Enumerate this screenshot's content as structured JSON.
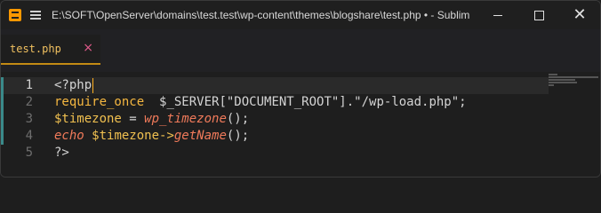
{
  "window": {
    "title": "E:\\SOFT\\OpenServer\\domains\\test.test\\wp-content\\themes\\blogshare\\test.php • - Sublim",
    "controls": {
      "minimize": "minimize",
      "maximize": "maximize",
      "close": "✕"
    }
  },
  "tabs": [
    {
      "label": "test.php",
      "close": "×",
      "active": true
    }
  ],
  "editor": {
    "lines": [
      {
        "number": "1",
        "tokens": [
          "<?php"
        ]
      },
      {
        "number": "2",
        "tokens": [
          "require_once",
          "  ",
          "$_SERVER[\"DOCUMENT_ROOT\"].\"/wp-load.php\";"
        ]
      },
      {
        "number": "3",
        "tokens": [
          "$timezone",
          " = ",
          "wp_timezone",
          "();"
        ]
      },
      {
        "number": "4",
        "tokens": [
          "echo",
          " ",
          "$timezone->",
          "getName",
          "();"
        ]
      },
      {
        "number": "5",
        "tokens": [
          "?>"
        ]
      }
    ]
  },
  "colors": {
    "accent": "#c38a14",
    "keyword": "#f5b740",
    "function_italic": "#f07a5a",
    "background": "#1e1e1e"
  }
}
